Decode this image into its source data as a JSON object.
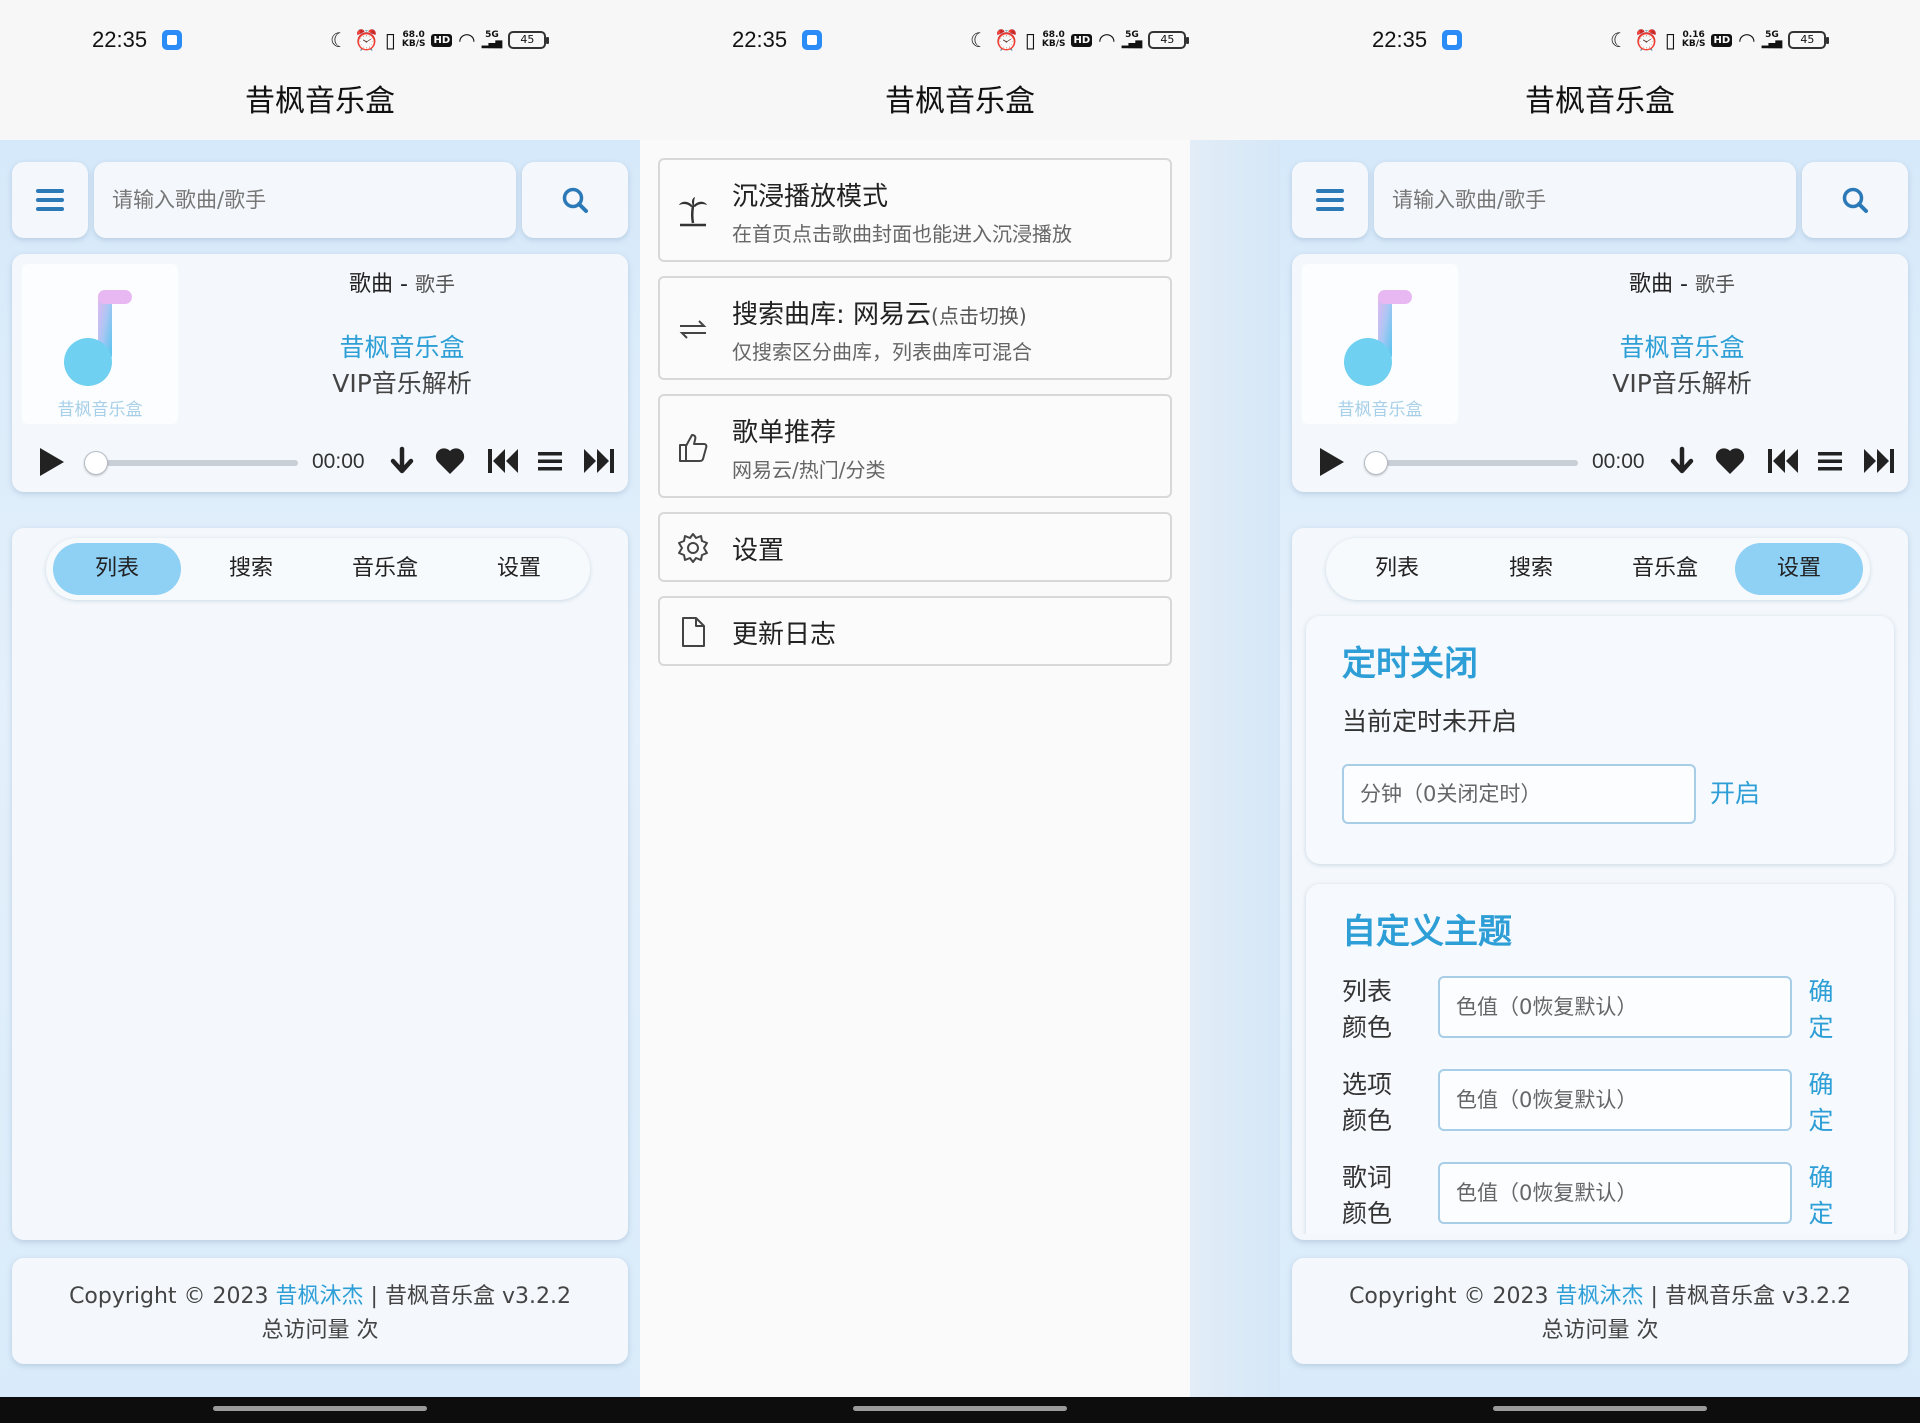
{
  "status_bar": {
    "time": "22:35",
    "net_speeds": [
      "68.0",
      "68.0",
      "0.16"
    ],
    "net_unit": "KB/S",
    "signal": "5G",
    "hd": "HD",
    "battery": "45"
  },
  "app": {
    "title": "昔枫音乐盒"
  },
  "search": {
    "placeholder": "请输入歌曲/歌手"
  },
  "player": {
    "song": "歌曲",
    "separator": " - ",
    "artist": "歌手",
    "brand": "昔枫音乐盒",
    "subtitle": "VIP音乐解析",
    "cover_caption": "昔枫音乐盒",
    "time": "00:00",
    "progress": 0
  },
  "tabs": [
    "列表",
    "搜索",
    "音乐盒",
    "设置"
  ],
  "footer": {
    "prefix": "Copyright © 2023 ",
    "author": "昔枫沐杰",
    "suffix": " | 昔枫音乐盒 v3.2.2",
    "visits": "总访问量 次"
  },
  "drawer": {
    "items": [
      {
        "title": "沉浸播放模式",
        "subtitle": "在首页点击歌曲封面也能进入沉浸播放",
        "icon": "palm-tree-icon"
      },
      {
        "title": "搜索曲库: 网易云",
        "title_small": "(点击切换)",
        "subtitle": "仅搜索区分曲库，列表曲库可混合",
        "icon": "swap-arrows-icon"
      },
      {
        "title": "歌单推荐",
        "subtitle": "网易云/热门/分类",
        "icon": "thumbs-up-icon"
      },
      {
        "title": "设置",
        "icon": "gear-icon"
      },
      {
        "title": "更新日志",
        "icon": "document-icon"
      }
    ]
  },
  "settings": {
    "timer": {
      "title": "定时关闭",
      "status": "当前定时未开启",
      "placeholder": "分钟（0关闭定时）",
      "action": "开启"
    },
    "theme": {
      "title": "自定义主题",
      "rows": [
        {
          "label": "列表颜色",
          "placeholder": "色值（0恢复默认）",
          "action": "确定"
        },
        {
          "label": "选项颜色",
          "placeholder": "色值（0恢复默认）",
          "action": "确定"
        },
        {
          "label": "歌词颜色",
          "placeholder": "色值（0恢复默认）",
          "action": "确定"
        }
      ]
    }
  },
  "colors": {
    "accent": "#2e9fd6",
    "tab_active": "#8fd0f5",
    "icon_blue": "#2c79b8"
  }
}
